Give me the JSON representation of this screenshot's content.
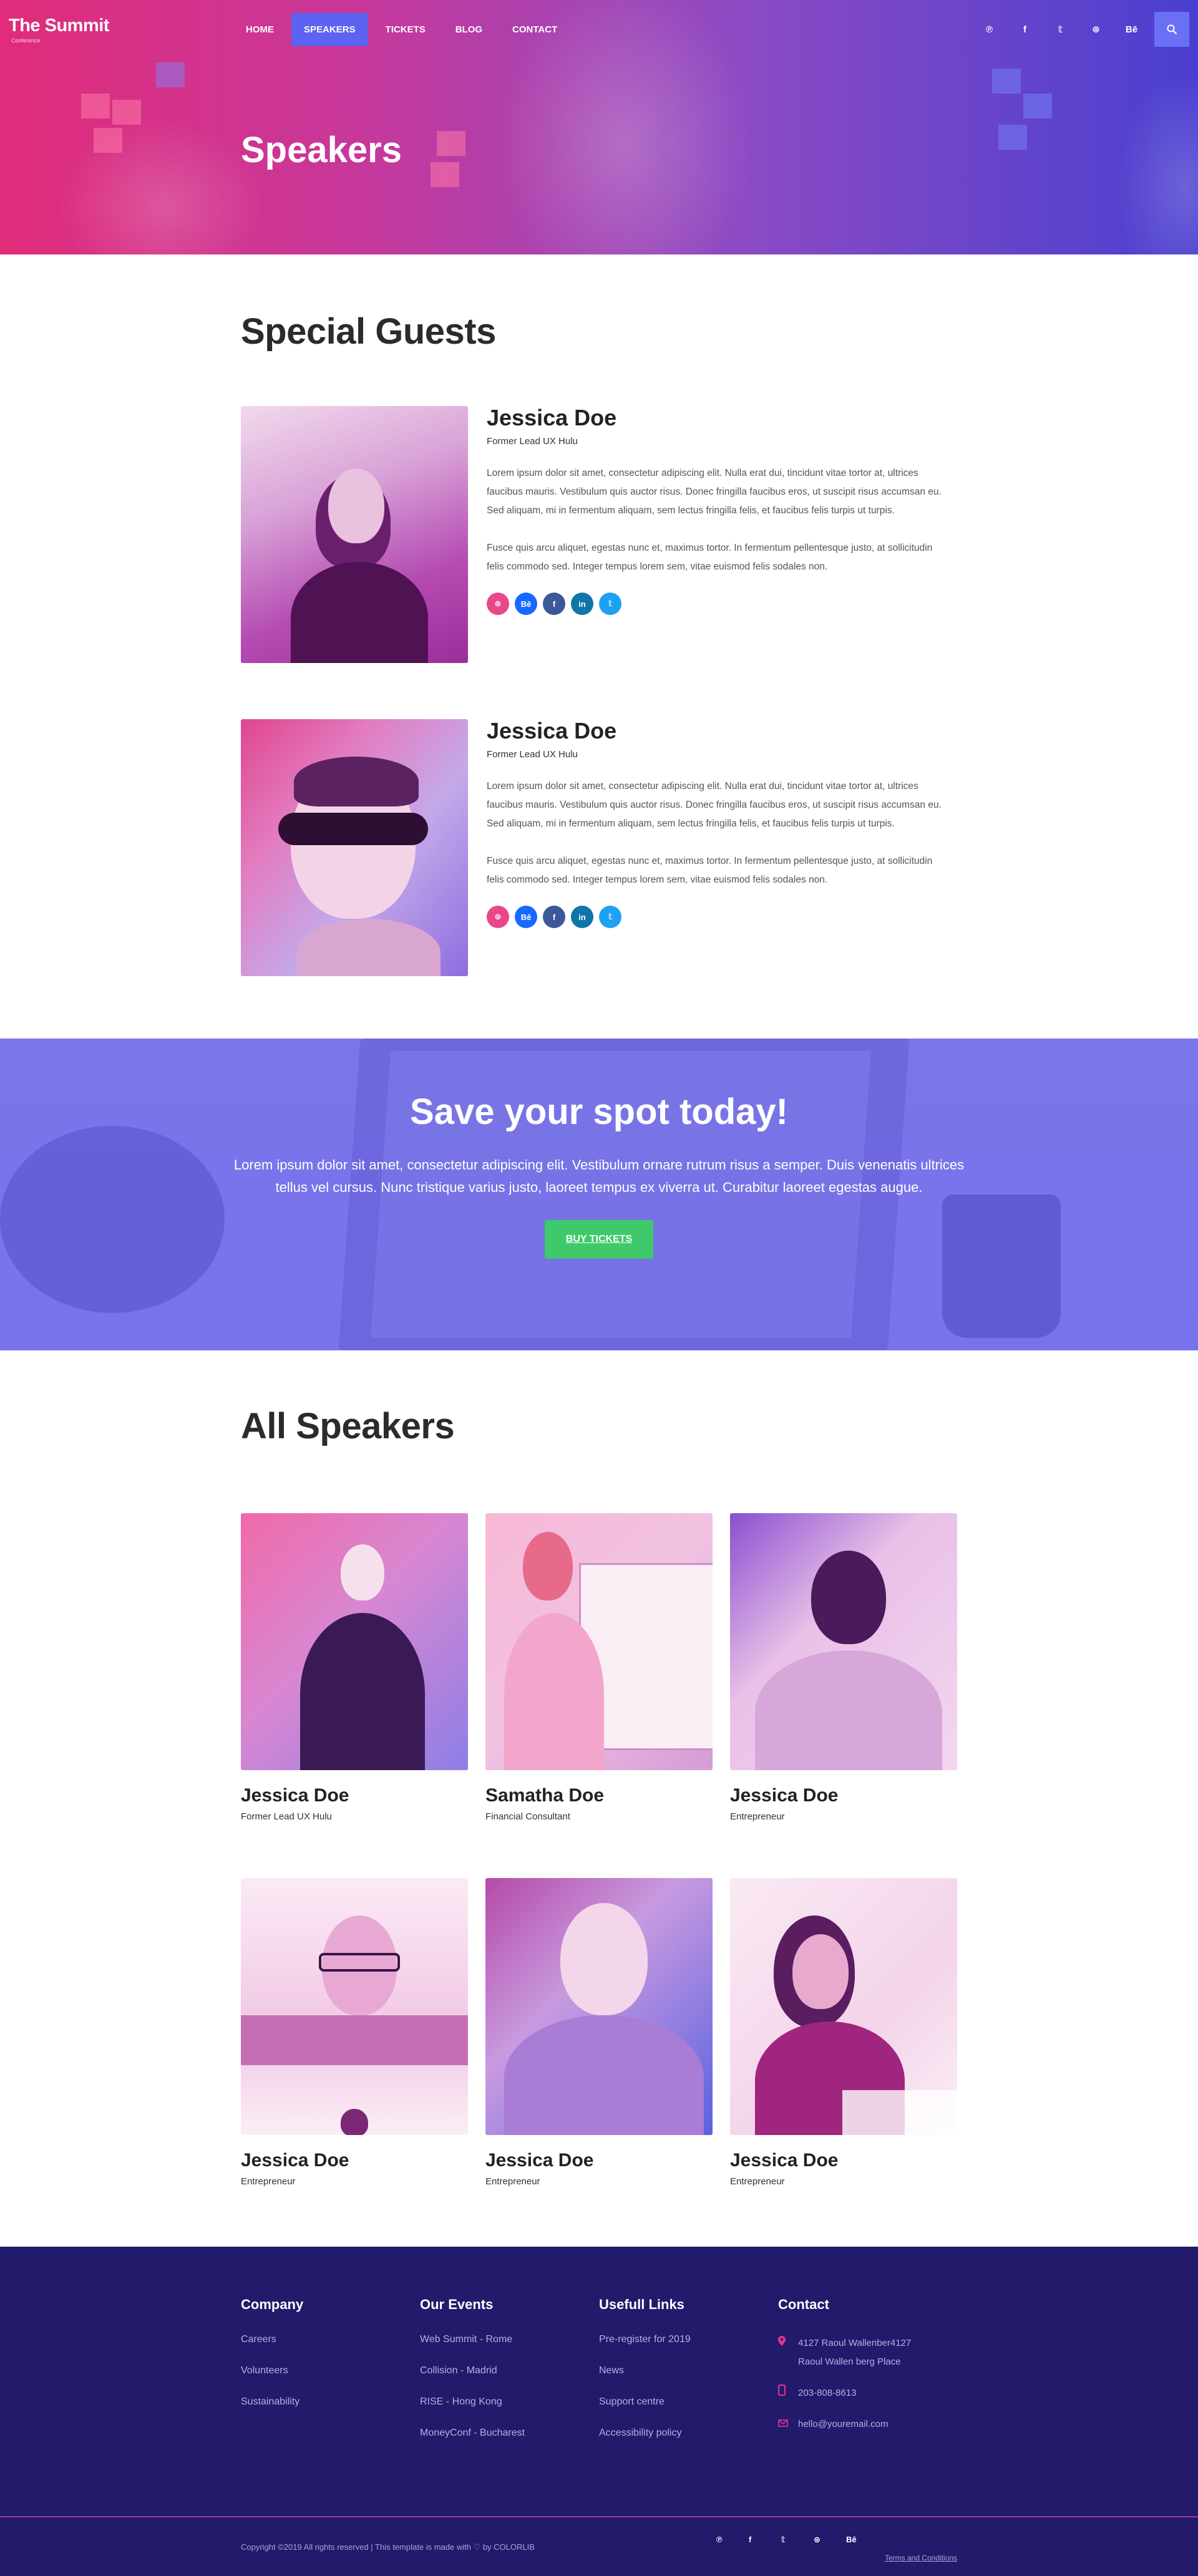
{
  "brand": {
    "title": "The Summit",
    "subtitle": "Conference"
  },
  "nav": {
    "items": [
      {
        "label": "Home",
        "active": false
      },
      {
        "label": "Speakers",
        "active": true
      },
      {
        "label": "Tickets",
        "active": false
      },
      {
        "label": "Blog",
        "active": false
      },
      {
        "label": "Contact",
        "active": false
      }
    ],
    "social": [
      "pinterest-icon",
      "facebook-icon",
      "twitter-icon",
      "dribbble-icon",
      "behance-icon"
    ],
    "social_glyphs": [
      "℗",
      "f",
      "𝕥",
      "⊛",
      "Bē"
    ]
  },
  "hero": {
    "title": "Speakers"
  },
  "special": {
    "title": "Special Guests",
    "guests": [
      {
        "name": "Jessica Doe",
        "role": "Former Lead UX Hulu",
        "p1": "Lorem ipsum dolor sit amet, consectetur adipiscing elit. Nulla erat dui, tincidunt vitae tortor at, ultrices faucibus mauris. Vestibulum quis auctor risus. Donec fringilla faucibus eros, ut suscipit risus accumsan eu. Sed aliquam, mi in fermentum aliquam, sem lectus fringilla felis, et faucibus felis turpis ut turpis.",
        "p2": "Fusce quis arcu aliquet, egestas nunc et, maximus tortor. In fermentum pellentesque justo, at sollicitudin felis commodo sed. Integer tempus lorem sem, vitae euismod felis sodales non."
      },
      {
        "name": "Jessica Doe",
        "role": "Former Lead UX Hulu",
        "p1": "Lorem ipsum dolor sit amet, consectetur adipiscing elit. Nulla erat dui, tincidunt vitae tortor at, ultrices faucibus mauris. Vestibulum quis auctor risus. Donec fringilla faucibus eros, ut suscipit risus accumsan eu. Sed aliquam, mi in fermentum aliquam, sem lectus fringilla felis, et faucibus felis turpis ut turpis.",
        "p2": "Fusce quis arcu aliquet, egestas nunc et, maximus tortor. In fermentum pellentesque justo, at sollicitudin felis commodo sed. Integer tempus lorem sem, vitae euismod felis sodales non."
      }
    ],
    "guest_social": [
      {
        "icon": "dribbble-icon",
        "glyph": "⊛",
        "color": "#e8478b"
      },
      {
        "icon": "behance-icon",
        "glyph": "Bē",
        "color": "#1769ff"
      },
      {
        "icon": "facebook-icon",
        "glyph": "f",
        "color": "#3b5998"
      },
      {
        "icon": "linkedin-icon",
        "glyph": "in",
        "color": "#0e76a8"
      },
      {
        "icon": "twitter-icon",
        "glyph": "𝕥",
        "color": "#1da1f2"
      }
    ]
  },
  "cta": {
    "title": "Save your spot today!",
    "text": "Lorem ipsum dolor sit amet, consectetur adipiscing elit. Vestibulum ornare rutrum risus a semper. Duis venenatis ultrices tellus vel cursus. Nunc tristique varius justo, laoreet tempus ex viverra ut. Curabitur laoreet egestas augue.",
    "button": "Buy Tickets"
  },
  "all": {
    "title": "All Speakers",
    "speakers": [
      {
        "name": "Jessica Doe",
        "role": "Former Lead UX Hulu"
      },
      {
        "name": "Samatha Doe",
        "role": "Financial Consultant"
      },
      {
        "name": "Jessica Doe",
        "role": "Entrepreneur"
      },
      {
        "name": "Jessica Doe",
        "role": "Entrepreneur"
      },
      {
        "name": "Jessica Doe",
        "role": "Entrepreneur"
      },
      {
        "name": "Jessica Doe",
        "role": "Entrepreneur"
      }
    ]
  },
  "footer": {
    "company": {
      "title": "Company",
      "links": [
        "Careers",
        "Volunteers",
        "Sustainability"
      ]
    },
    "events": {
      "title": "Our Events",
      "links": [
        "Web Summit - Rome",
        "Collision - Madrid",
        "RISE - Hong Kong",
        "MoneyConf - Bucharest"
      ]
    },
    "useful": {
      "title": "Usefull Links",
      "links": [
        "Pre-register for 2019",
        "News",
        "Support centre",
        "Accessibility policy"
      ]
    },
    "contact": {
      "title": "Contact",
      "address": "4127 Raoul Wallenber4127 Raoul Wallen berg Place",
      "phone": "203-808-8613",
      "email": "hello@youremail.com"
    },
    "copyright": "Copyright ©2019 All rights reserved | This template is made with ♡ by COLORLIB",
    "terms": "Terms and Conditions"
  }
}
